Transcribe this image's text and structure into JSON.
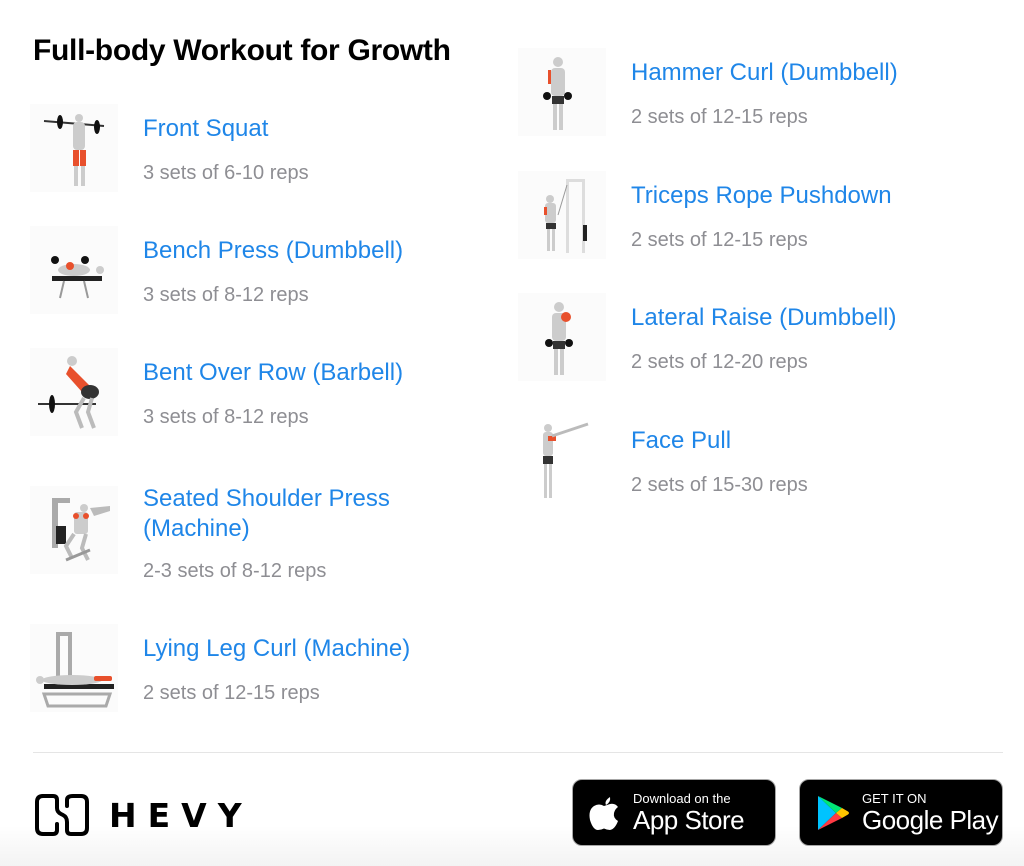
{
  "title": "Full-body Workout for Growth",
  "colors": {
    "accent": "#1f86e8",
    "muted": "#8e8e93",
    "muscle": "#e8502c"
  },
  "left_column": [
    {
      "name": "Front Squat",
      "sets": "3 sets of 6-10 reps",
      "icon": "front-squat-illustration"
    },
    {
      "name": "Bench Press (Dumbbell)",
      "sets": "3 sets of 8-12 reps",
      "icon": "bench-press-illustration"
    },
    {
      "name": "Bent Over Row (Barbell)",
      "sets": "3 sets of 8-12 reps",
      "icon": "bent-over-row-illustration"
    },
    {
      "name": "Seated Shoulder Press (Machine)",
      "sets": "2-3 sets of 8-12 reps",
      "icon": "shoulder-press-machine-illustration"
    },
    {
      "name": "Lying Leg Curl (Machine)",
      "sets": "2 sets of 12-15 reps",
      "icon": "leg-curl-machine-illustration"
    }
  ],
  "right_column": [
    {
      "name": "Hammer Curl (Dumbbell)",
      "sets": "2 sets of 12-15 reps",
      "icon": "hammer-curl-illustration"
    },
    {
      "name": "Triceps Rope Pushdown",
      "sets": "2 sets of 12-15 reps",
      "icon": "triceps-pushdown-illustration"
    },
    {
      "name": "Lateral Raise (Dumbbell)",
      "sets": "2 sets of 12-20 reps",
      "icon": "lateral-raise-illustration"
    },
    {
      "name": "Face Pull",
      "sets": "2 sets of 15-30 reps",
      "icon": "face-pull-illustration"
    }
  ],
  "footer": {
    "brand": "HEVY",
    "app_store": {
      "small": "Download on the",
      "big": "App Store"
    },
    "google_play": {
      "small": "GET IT ON",
      "big": "Google Play"
    }
  }
}
